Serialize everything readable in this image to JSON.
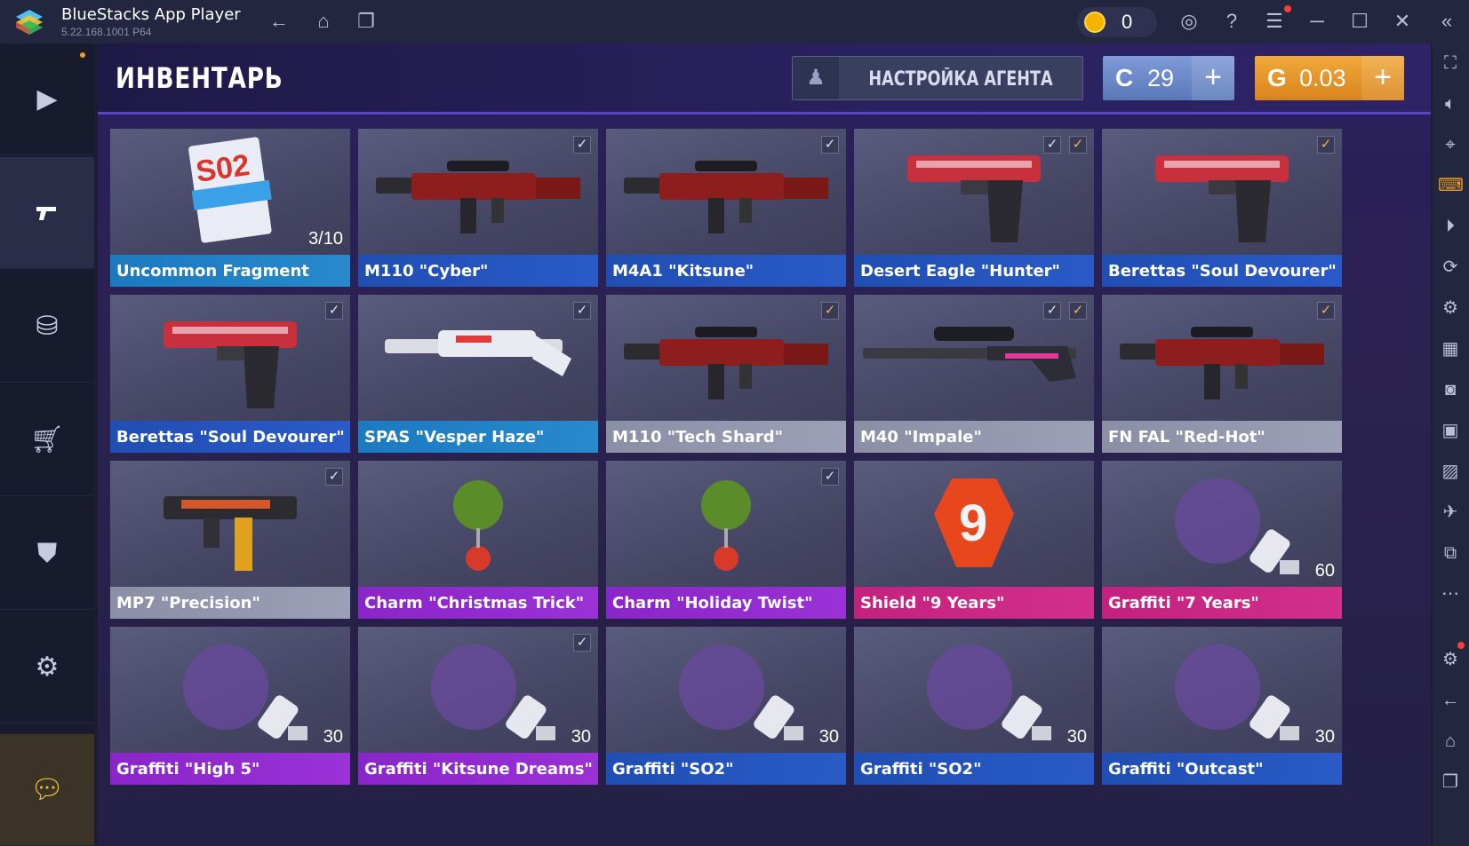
{
  "titlebar": {
    "app_name": "BlueStacks App Player",
    "version": "5.22.168.1001  P64",
    "coins": "0",
    "icons": [
      "back-icon",
      "home-icon",
      "multi-window-icon",
      "account-icon",
      "help-icon",
      "menu-icon",
      "minimize-icon",
      "maximize-icon",
      "close-icon",
      "collapse-icon"
    ]
  },
  "header": {
    "title": "ИНВЕНТАРЬ",
    "agent_button": "НАСТРОЙКА АГЕНТА",
    "silver": {
      "symbol": "C",
      "value": "29"
    },
    "gold": {
      "symbol": "G",
      "value": "0.03"
    },
    "plus": "+"
  },
  "leftnav": [
    "play-icon",
    "gun-icon",
    "coins-icon",
    "cart-icon",
    "clan-icon",
    "gear-icon",
    "chat-icon"
  ],
  "items": [
    {
      "name": "Uncommon Fragment",
      "rarity": "teal",
      "count": "3/10",
      "checks": 0,
      "art": "S02"
    },
    {
      "name": "M110 \"Cyber\"",
      "rarity": "blue",
      "checks": 1,
      "art": "rifle"
    },
    {
      "name": "M4A1 \"Kitsune\"",
      "rarity": "blue",
      "checks": 1,
      "art": "rifle"
    },
    {
      "name": "Desert Eagle \"Hunter\"",
      "rarity": "blue",
      "checks": 2,
      "art": "pistol"
    },
    {
      "name": "Berettas \"Soul Devourer\"",
      "rarity": "blue",
      "checks": 1,
      "gold": true,
      "art": "pistol"
    },
    {
      "name": "Berettas \"Soul Devourer\"",
      "rarity": "blue",
      "checks": 1,
      "art": "pistol"
    },
    {
      "name": "SPAS \"Vesper Haze\"",
      "rarity": "teal",
      "checks": 1,
      "art": "shotgun"
    },
    {
      "name": "M110 \"Tech Shard\"",
      "rarity": "grey",
      "checks": 1,
      "gold": true,
      "art": "rifle"
    },
    {
      "name": "M40 \"Impale\"",
      "rarity": "grey",
      "checks": 2,
      "art": "sniper"
    },
    {
      "name": "FN FAL \"Red-Hot\"",
      "rarity": "grey",
      "checks": 1,
      "gold": true,
      "art": "rifle"
    },
    {
      "name": "MP7 \"Precision\"",
      "rarity": "grey",
      "checks": 1,
      "art": "smg"
    },
    {
      "name": "Charm \"Christmas Trick\"",
      "rarity": "purple",
      "checks": 0,
      "art": "charm"
    },
    {
      "name": "Charm \"Holiday Twist\"",
      "rarity": "purple",
      "checks": 1,
      "art": "charm"
    },
    {
      "name": "Shield \"9 Years\"",
      "rarity": "pink",
      "checks": 0,
      "art": "badge"
    },
    {
      "name": "Graffiti \"7 Years\"",
      "rarity": "pink",
      "checks": 0,
      "count": "60",
      "art": "graffiti"
    },
    {
      "name": "Graffiti \"High 5\"",
      "rarity": "purple",
      "checks": 0,
      "count": "30",
      "art": "graffiti"
    },
    {
      "name": "Graffiti \"Kitsune Dreams\"",
      "rarity": "purple",
      "checks": 1,
      "count": "30",
      "art": "graffiti"
    },
    {
      "name": "Graffiti \"SO2\"",
      "rarity": "blue",
      "checks": 0,
      "count": "30",
      "art": "graffiti"
    },
    {
      "name": "Graffiti \"SO2\"",
      "rarity": "blue",
      "checks": 0,
      "count": "30",
      "art": "graffiti"
    },
    {
      "name": "Graffiti \"Outcast\"",
      "rarity": "blue",
      "checks": 0,
      "count": "30",
      "art": "graffiti"
    }
  ]
}
